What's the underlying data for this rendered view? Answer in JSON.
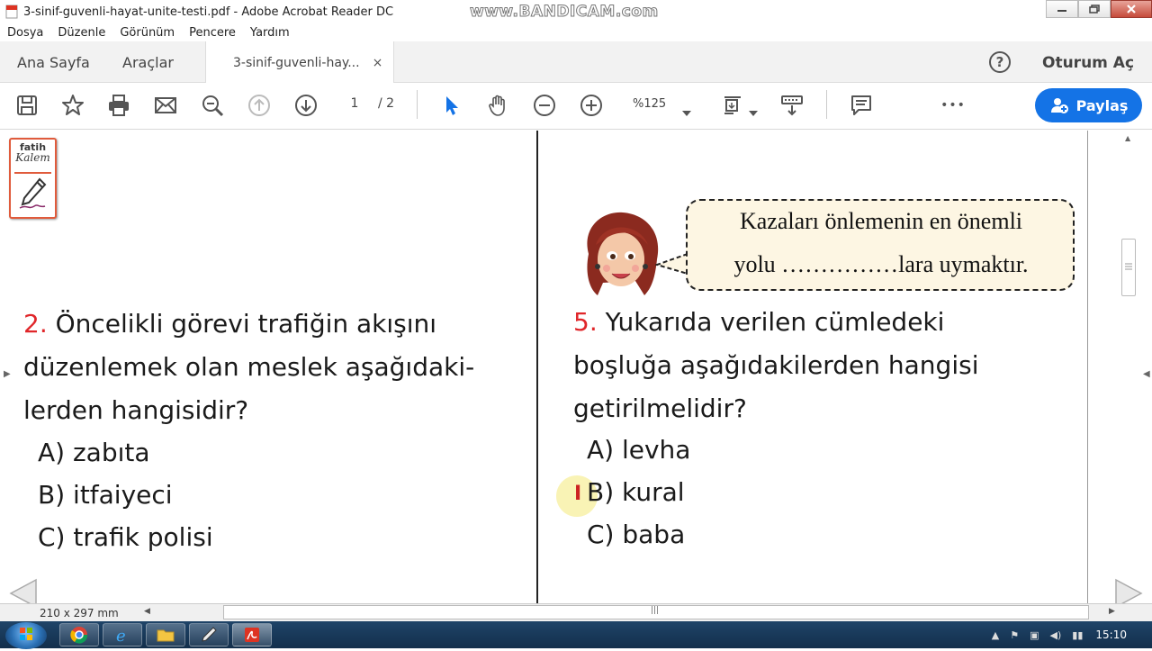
{
  "window": {
    "title": "3-sinif-guvenli-hayat-unite-testi.pdf - Adobe Acrobat Reader DC",
    "watermark": "www.BANDICAM.com"
  },
  "menu": [
    "Dosya",
    "Düzenle",
    "Görünüm",
    "Pencere",
    "Yardım"
  ],
  "tabs": {
    "home": "Ana Sayfa",
    "tools": "Araçlar",
    "doc": "3-sinif-guvenli-hay...",
    "close": "×",
    "login": "Oturum Aç",
    "help": "?"
  },
  "toolbar": {
    "page_current": "1",
    "page_total": "/ 2",
    "zoom": "%125",
    "share": "Paylaş",
    "more": "•••"
  },
  "document": {
    "logo_top": "fatih",
    "logo_bottom": "Kalem",
    "q2": {
      "number": "2.",
      "line1": " Öncelikli görevi trafiğin akışını",
      "line2": "düzenlemek olan meslek aşağıdaki-",
      "line3": "lerden hangisidir?",
      "options": [
        "A) zabıta",
        "B) itfaiyeci",
        "C) trafik polisi"
      ]
    },
    "bubble": {
      "line1": "Kazaları önlemenin en önemli",
      "line2": "yolu ……………lara uymaktır."
    },
    "q5": {
      "number": "5.",
      "line1": " Yukarıda verilen cümledeki",
      "line2": "boşluğa aşağıdakilerden hangisi",
      "line3": "getirilmelidir?",
      "options": [
        "A) levha",
        "B) kural",
        "C) baba"
      ]
    }
  },
  "status": {
    "page_size": "210 x 297 mm"
  },
  "taskbar": {
    "clock": "15:10"
  }
}
